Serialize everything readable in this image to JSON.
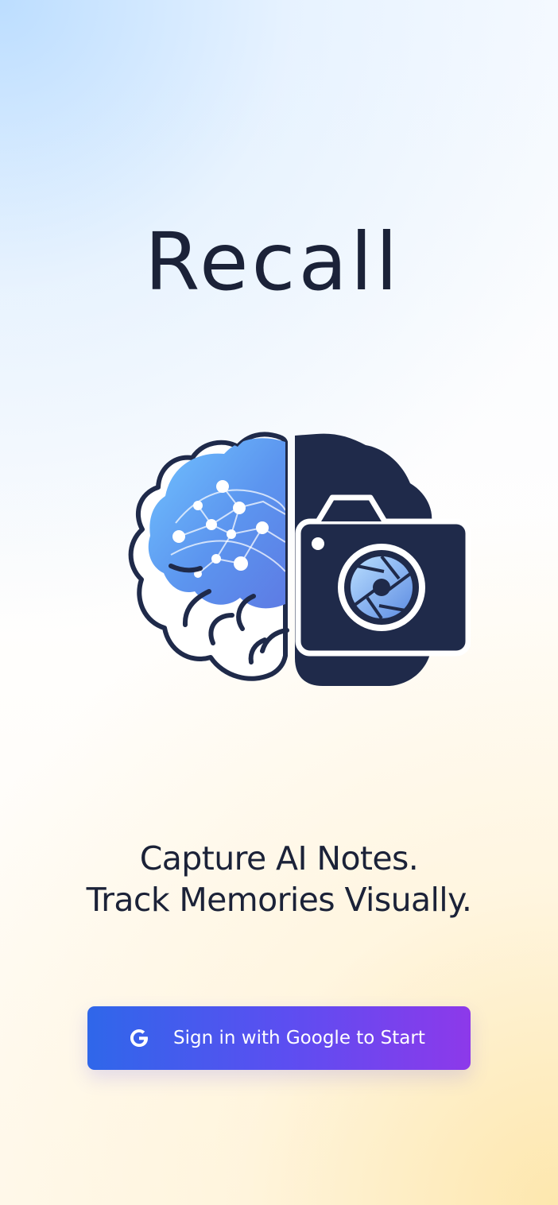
{
  "app": {
    "title": "Recall"
  },
  "tagline": {
    "line1": "Capture AI Notes.",
    "line2": "Track Memories Visually."
  },
  "signin": {
    "label": "Sign in with Google to Start",
    "icon": "google-icon"
  },
  "colors": {
    "text_dark": "#1b2238",
    "button_start": "#2f67ea",
    "button_end": "#8d39ea",
    "brain_blue": "#63a9f4",
    "camera_dark": "#1f2a4a"
  }
}
